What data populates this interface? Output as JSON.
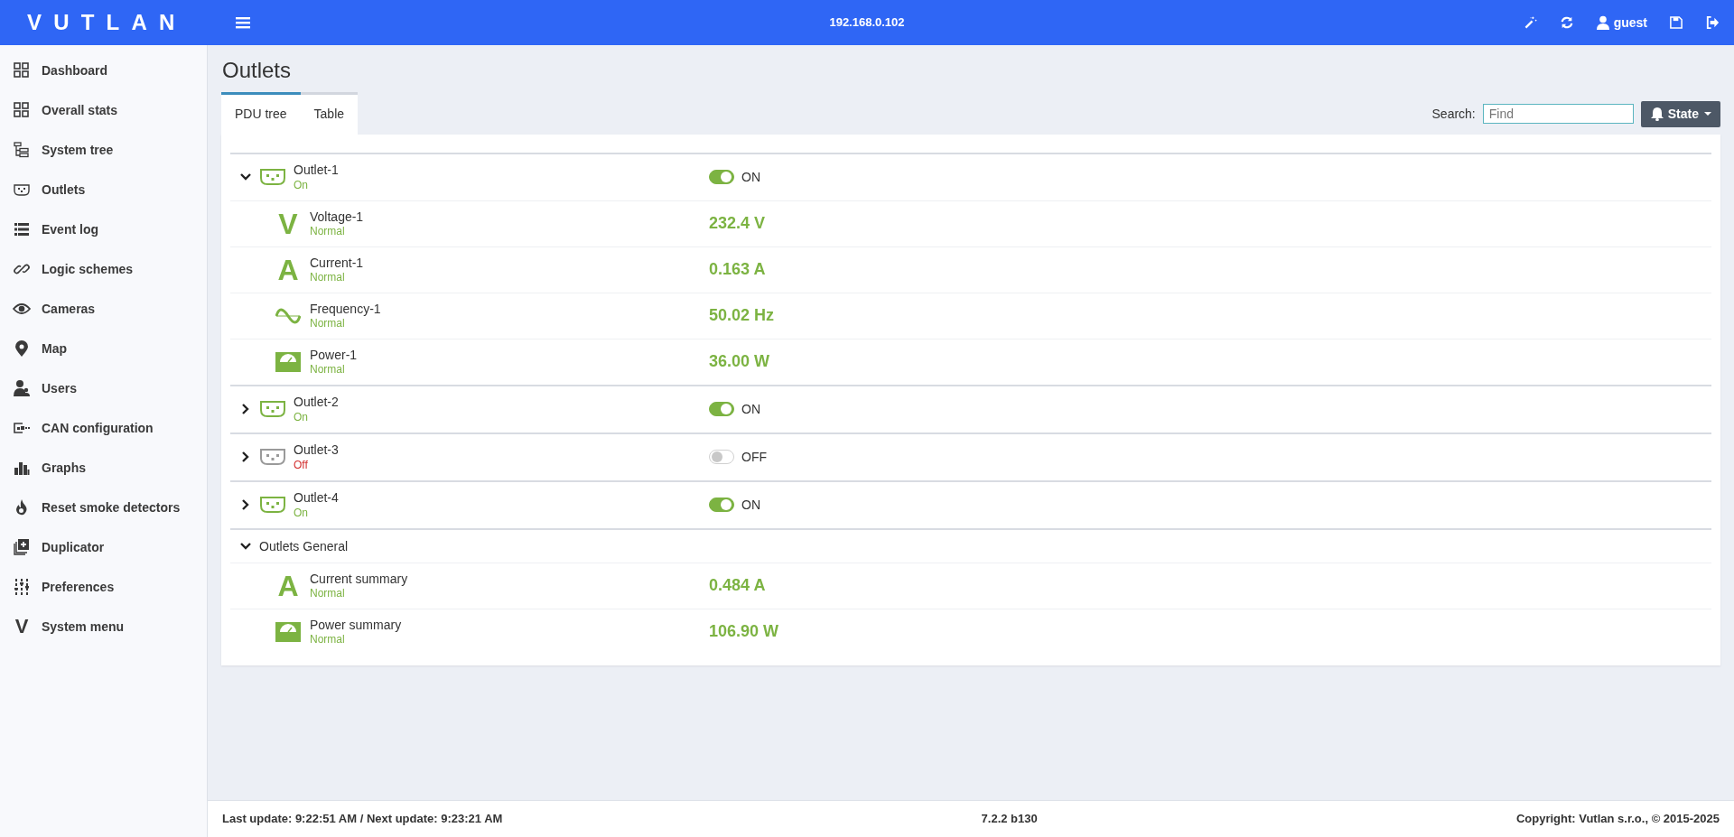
{
  "header": {
    "logo": "VUTLAN",
    "address": "192.168.0.102",
    "user": "guest"
  },
  "sidebar": {
    "items": [
      {
        "label": "Dashboard"
      },
      {
        "label": "Overall stats"
      },
      {
        "label": "System tree"
      },
      {
        "label": "Outlets"
      },
      {
        "label": "Event log"
      },
      {
        "label": "Logic schemes"
      },
      {
        "label": "Cameras"
      },
      {
        "label": "Map"
      },
      {
        "label": "Users"
      },
      {
        "label": "CAN configuration"
      },
      {
        "label": "Graphs"
      },
      {
        "label": "Reset smoke detectors"
      },
      {
        "label": "Duplicator"
      },
      {
        "label": "Preferences"
      },
      {
        "label": "System menu",
        "symbol": "V"
      }
    ]
  },
  "page": {
    "title": "Outlets"
  },
  "tabs": [
    {
      "label": "PDU tree",
      "selected": true
    },
    {
      "label": "Table",
      "selected": false
    }
  ],
  "search": {
    "label": "Search:",
    "placeholder": "Find"
  },
  "state_button": {
    "label": "State"
  },
  "groups": [
    {
      "kind": "outlet",
      "name": "Outlet-1",
      "status": "On",
      "on": true,
      "switch_label": "ON",
      "expanded": true,
      "sensors": [
        {
          "kind": "voltage",
          "symbol": "V",
          "name": "Voltage-1",
          "status": "Normal",
          "value": "232.4 V"
        },
        {
          "kind": "current",
          "symbol": "A",
          "name": "Current-1",
          "status": "Normal",
          "value": "0.163 A"
        },
        {
          "kind": "frequency",
          "name": "Frequency-1",
          "status": "Normal",
          "value": "50.02 Hz"
        },
        {
          "kind": "power",
          "name": "Power-1",
          "status": "Normal",
          "value": "36.00 W"
        }
      ]
    },
    {
      "kind": "outlet",
      "name": "Outlet-2",
      "status": "On",
      "on": true,
      "switch_label": "ON",
      "expanded": false
    },
    {
      "kind": "outlet",
      "name": "Outlet-3",
      "status": "Off",
      "on": false,
      "switch_label": "OFF",
      "expanded": false
    },
    {
      "kind": "outlet",
      "name": "Outlet-4",
      "status": "On",
      "on": true,
      "switch_label": "ON",
      "expanded": false
    },
    {
      "kind": "group",
      "name": "Outlets General",
      "expanded": true,
      "sensors": [
        {
          "kind": "current",
          "symbol": "A",
          "name": "Current summary",
          "status": "Normal",
          "value": "0.484 A"
        },
        {
          "kind": "power",
          "name": "Power summary",
          "status": "Normal",
          "value": "106.90 W"
        }
      ]
    }
  ],
  "footer": {
    "last_update": "Last update: 9:22:51 AM / Next update: 9:23:21 AM",
    "version": "7.2.2 b130",
    "copyright": "Copyright: Vutlan s.r.o., © 2015-2025"
  }
}
